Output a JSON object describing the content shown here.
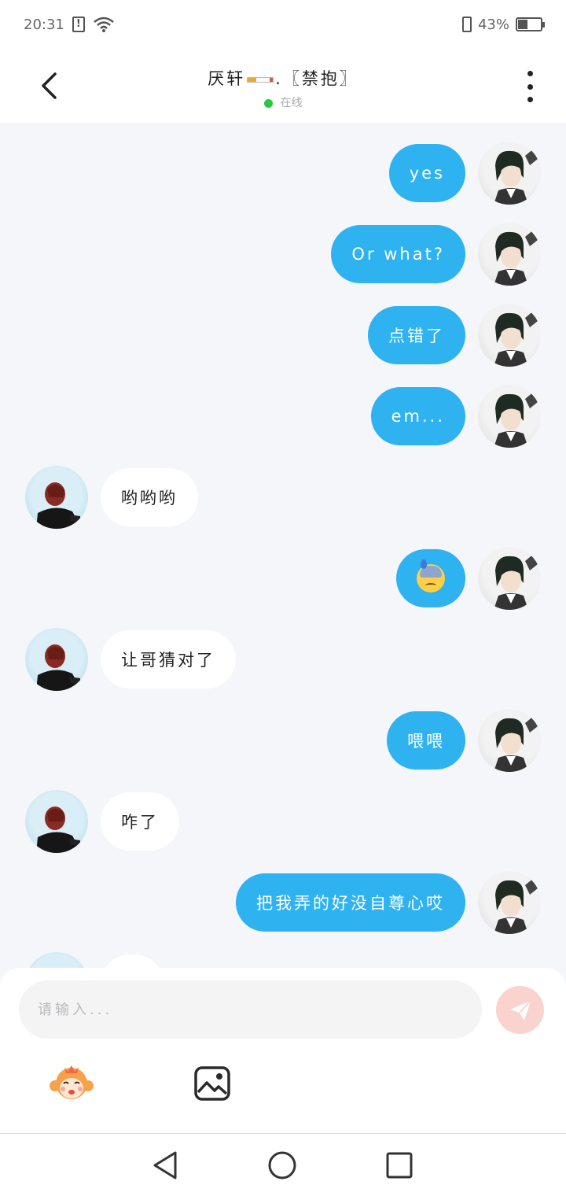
{
  "status_bar": {
    "time": "20:31",
    "battery_text": "43%",
    "battery_level": 0.43
  },
  "header": {
    "title_name": "厌轩",
    "title_suffix": ".〖禁抱〗",
    "status_text": "在线",
    "status_color": "#28c840"
  },
  "messages": [
    {
      "sender": "me",
      "text": "yes"
    },
    {
      "sender": "me",
      "text": "Or what?"
    },
    {
      "sender": "me",
      "text": "点错了"
    },
    {
      "sender": "me",
      "text": "em..."
    },
    {
      "sender": "them",
      "text": "哟哟哟"
    },
    {
      "sender": "me",
      "emoji": "anxious-sweat-face-emoji"
    },
    {
      "sender": "them",
      "text": "让哥猜对了"
    },
    {
      "sender": "me",
      "text": "喂喂"
    },
    {
      "sender": "them",
      "text": "咋了"
    },
    {
      "sender": "me",
      "text": "把我弄的好没自尊心哎"
    }
  ],
  "input": {
    "placeholder": "请输入...",
    "value": ""
  },
  "colors": {
    "my_bubble": "#2eb2f0",
    "their_bubble": "#ffffff",
    "chat_background": "#f4f6f9",
    "send_button": "#fbd3ce"
  },
  "icons": {
    "back": "chevron-left-icon",
    "more": "more-vertical-icon",
    "send": "paper-plane-icon",
    "emoji": "monkey-emoji-icon",
    "image": "image-icon"
  }
}
